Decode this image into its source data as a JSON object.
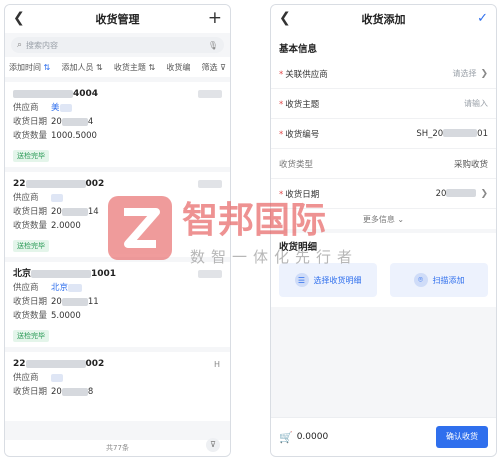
{
  "left": {
    "title": "收货管理",
    "add_icon": "plus-icon",
    "search_placeholder": "搜索内容",
    "filters": [
      "添加时间",
      "添加人员",
      "收货主题",
      "收货编",
      "筛选"
    ],
    "cards": [
      {
        "code_suffix": "4004",
        "supplier_label": "供应商",
        "supplier": "美",
        "date_label": "收货日期",
        "date": "20",
        "date_tail": "4",
        "qty_label": "收货数量",
        "qty": "1000.5000",
        "status": "送检完毕"
      },
      {
        "code_prefix": "22",
        "code_suffix": "002",
        "supplier_label": "供应商",
        "supplier": "",
        "date_label": "收货日期",
        "date": "20",
        "date_tail": "14",
        "qty_label": "收货数量",
        "qty": "2.0000",
        "status": "送检完毕"
      },
      {
        "code_prefix": "北京",
        "code_suffix": "1001",
        "supplier_label": "供应商",
        "supplier": "北京",
        "date_label": "收货日期",
        "date": "20",
        "date_tail": "11",
        "qty_label": "收货数量",
        "qty": "5.0000",
        "status": "送检完毕"
      },
      {
        "code_prefix": "22",
        "code_suffix": "002",
        "supplier_label": "供应商",
        "supplier": "",
        "date_label": "收货日期",
        "date": "20",
        "date_tail": "8",
        "corner": "H"
      }
    ],
    "total": "共77条"
  },
  "right": {
    "title": "收货添加",
    "section_basic": "基本信息",
    "fields": [
      {
        "label": "关联供应商",
        "required": true,
        "value": "请选择",
        "chevron": true
      },
      {
        "label": "收货主题",
        "required": true,
        "value": "请输入",
        "chevron": false
      },
      {
        "label": "收货编号",
        "required": true,
        "value_prefix": "SH_20",
        "value_suffix": "01",
        "chevron": false
      },
      {
        "label": "收货类型",
        "required": false,
        "value": "采购收货",
        "chevron": false
      },
      {
        "label": "收货日期",
        "required": true,
        "value_prefix": "20",
        "chevron": true
      }
    ],
    "more": "更多信息",
    "detail_title": "收货明细",
    "btn_select": "选择收货明细",
    "btn_scan": "扫描添加",
    "amount": "0.0000",
    "confirm": "确认收货"
  },
  "watermark": {
    "brand": "智邦国际",
    "slogan": "数智一体化先行者",
    "color": "#e34b4b"
  }
}
